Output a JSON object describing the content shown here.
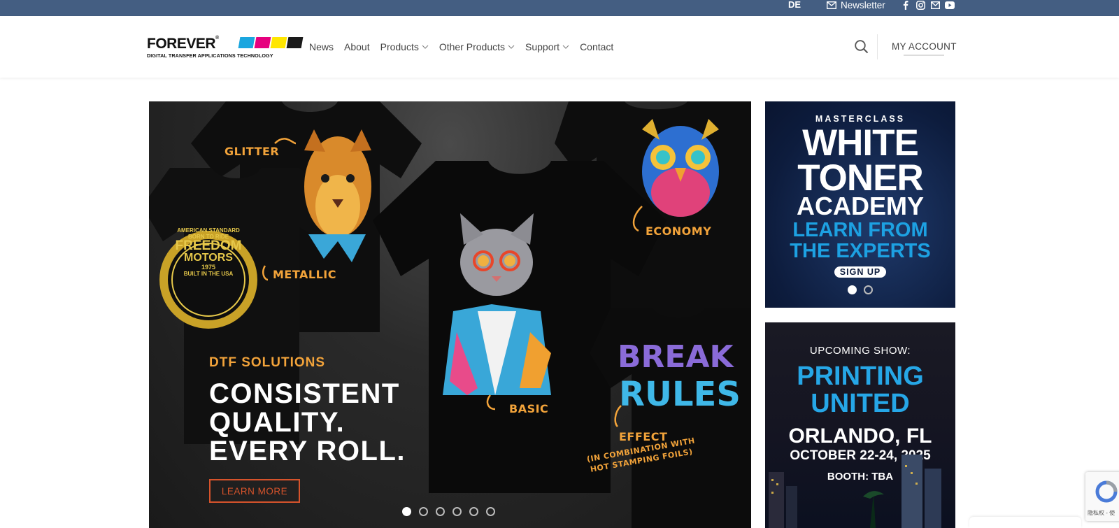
{
  "topbar": {
    "language": "DE",
    "newsletter_label": "Newsletter",
    "social_icons": [
      "facebook-icon",
      "instagram-icon",
      "email-icon",
      "youtube-icon"
    ],
    "bg_color": "#445e82"
  },
  "header": {
    "logo": {
      "wordmark": "FOREVER",
      "tagline": "DIGITAL TRANSFER APPLICATIONS TECHNOLOGY",
      "swatch_colors": [
        "#1aa6df",
        "#e6007e",
        "#ffe600",
        "#1a1a1a"
      ]
    },
    "nav": [
      {
        "label": "News",
        "dropdown": false
      },
      {
        "label": "About",
        "dropdown": false
      },
      {
        "label": "Products",
        "dropdown": true
      },
      {
        "label": "Other Products",
        "dropdown": true
      },
      {
        "label": "Support",
        "dropdown": true
      },
      {
        "label": "Contact",
        "dropdown": false
      }
    ],
    "account_label": "MY ACCOUNT"
  },
  "hero": {
    "kicker": "DTF SOLUTIONS",
    "headline_lines": [
      "CONSISTENT",
      "QUALITY.",
      "EVERY ROLL."
    ],
    "cta_label": "LEARN MORE",
    "image_labels": {
      "glitter": "GLITTER",
      "metallic": "METALLIC",
      "economy": "ECONOMY",
      "basic": "BASIC",
      "effect": "EFFECT",
      "effect_note_1": "(IN COMBINATION WITH",
      "effect_note_2": "HOT STAMPING FOILS)",
      "break_1": "BREAK",
      "break_2": "RULES",
      "badge_top": "AMERICAN STANDARD",
      "badge_sub": "BORN TO RIDE",
      "badge_main_1": "FREEDOM",
      "badge_main_2": "MOTORS",
      "badge_year": "1975",
      "badge_bottom": "BUILT IN THE USA"
    },
    "slide_count": 6,
    "active_slide": 1,
    "accent_color": "#f2a33a",
    "cta_color": "#d6532b"
  },
  "side_banner_1": {
    "eyebrow": "MASTERCLASS",
    "title_1": "WHITE",
    "title_2": "TONER",
    "title_3": "ACADEMY",
    "subtitle_1": "LEARN FROM",
    "subtitle_2": "THE EXPERTS",
    "cta": "SIGN UP",
    "slide_count": 2,
    "active_slide": 1
  },
  "side_banner_2": {
    "eyebrow": "UPCOMING SHOW:",
    "title_1": "PRINTING",
    "title_2": "UNITED",
    "city": "ORLANDO, FL",
    "dates": "OCTOBER 22-24, 2025",
    "booth": "BOOTH: TBA"
  },
  "recaptcha": {
    "text": "隐私权 - 使"
  }
}
